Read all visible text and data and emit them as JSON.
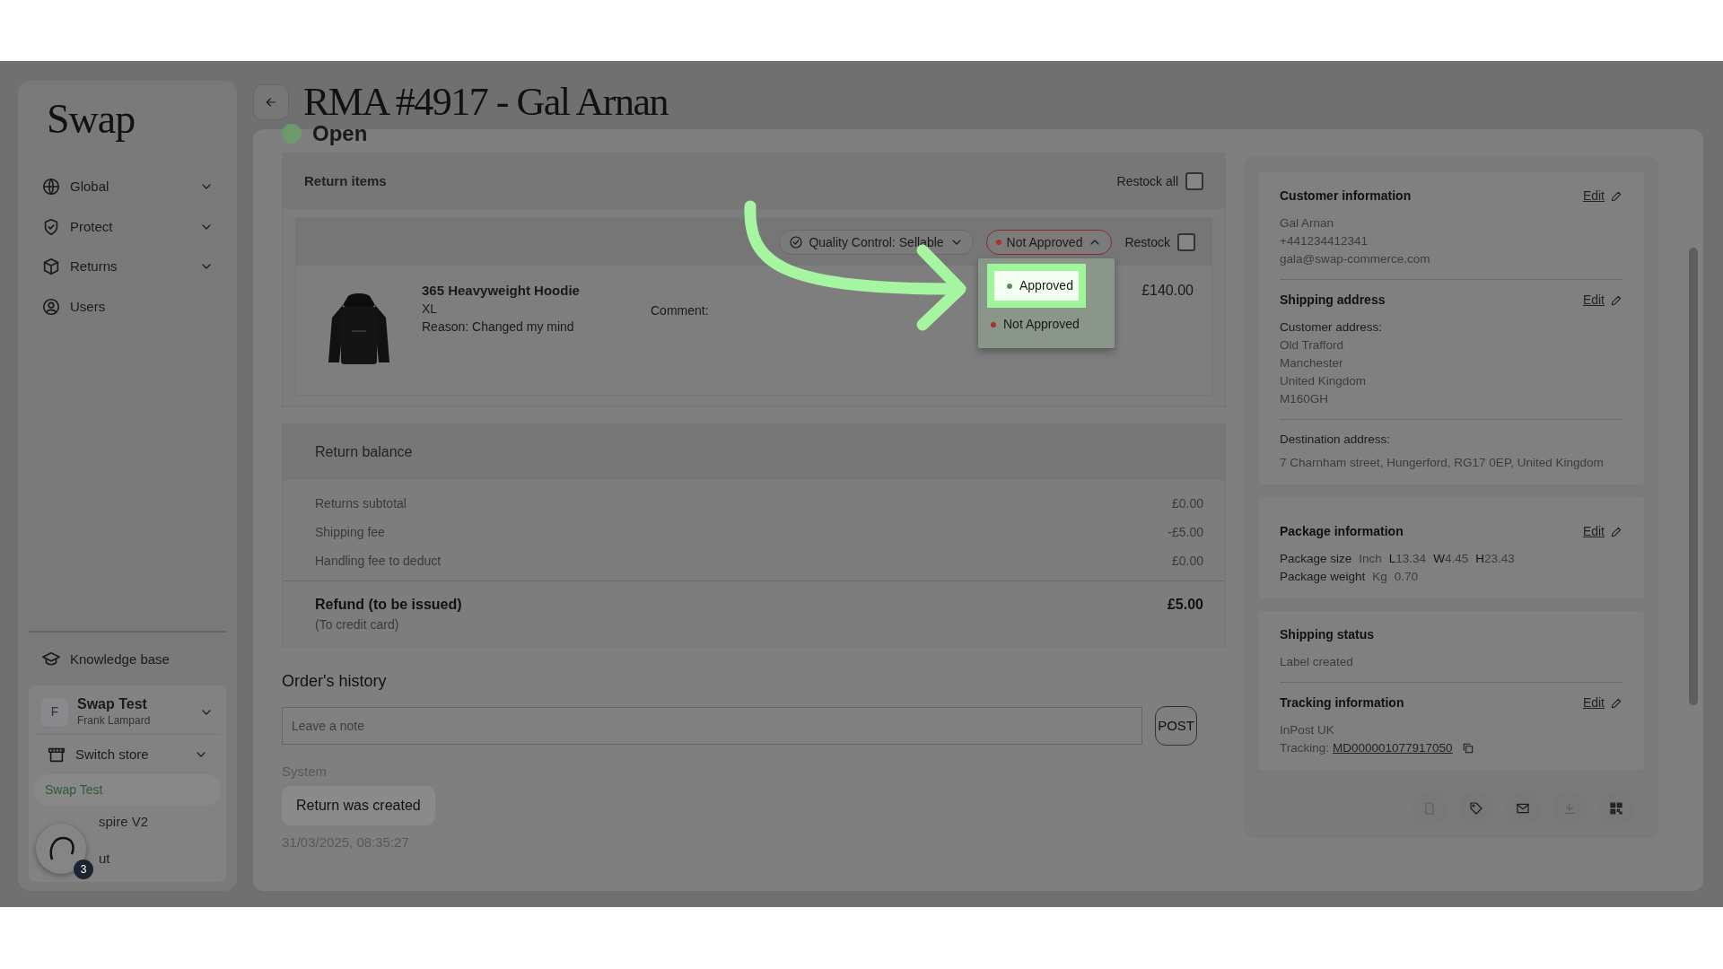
{
  "sidebar": {
    "logo": "Swap",
    "nav": [
      {
        "label": "Global",
        "expandable": true
      },
      {
        "label": "Protect",
        "expandable": true
      },
      {
        "label": "Returns",
        "expandable": true
      },
      {
        "label": "Users",
        "expandable": false
      }
    ],
    "knowledge_base": "Knowledge base",
    "account": {
      "initial": "F",
      "name": "Swap Test",
      "user": "Frank Lampard"
    },
    "switch_store": "Switch store",
    "stores": [
      {
        "label": "Swap Test",
        "selected": true
      },
      {
        "label": "spire V2",
        "selected": false
      }
    ],
    "logout": "ut",
    "chat": {
      "badge": "3"
    }
  },
  "header": {
    "title": "RMA #4917 - Gal Arnan",
    "status": "Open"
  },
  "return_items": {
    "title": "Return items",
    "restock_all": {
      "label": "Restock all",
      "checked": false
    },
    "items": [
      {
        "qc": "Quality Control: Sellable",
        "approval": "Not Approved",
        "restock": {
          "label": "Restock",
          "checked": false
        },
        "name": "365 Heavyweight Hoodie",
        "size": "XL",
        "reason": "Reason: Changed my mind",
        "comment": "Comment:",
        "price": "£140.00",
        "menu_open": true
      }
    ]
  },
  "approval_menu": [
    {
      "label": "Approved",
      "color": "#5c8f5c",
      "highlighted": true
    },
    {
      "label": "Not Approved",
      "color": "#a83232",
      "highlighted": false
    }
  ],
  "return_balance": {
    "title": "Return balance",
    "rows": [
      {
        "label": "Returns subtotal",
        "value": "£0.00"
      },
      {
        "label": "Shipping fee",
        "value": "-£5.00"
      },
      {
        "label": "Handling fee to deduct",
        "value": "£0.00"
      }
    ],
    "total": {
      "label": "Refund (to be issued)",
      "note": "(To credit card)",
      "value": "£5.00"
    }
  },
  "history": {
    "title": "Order's history",
    "placeholder": "Leave a note",
    "post": "POST",
    "entries": [
      {
        "author": "System",
        "message": "Return was created",
        "time": "31/03/2025, 08:35:27"
      }
    ]
  },
  "customer": {
    "title": "Customer information",
    "edit": "Edit",
    "lines": [
      "Gal Arnan",
      "+441234412341",
      "gala@swap-commerce.com"
    ]
  },
  "shipping_address": {
    "title": "Shipping address",
    "edit": "Edit",
    "customer_label": "Customer address:",
    "lines": [
      "Old Trafford",
      "Manchester",
      "United Kingdom",
      "M160GH"
    ],
    "destination_label": "Destination address:",
    "destination": "7 Charnham street, Hungerford, RG17 0EP, United Kingdom"
  },
  "package": {
    "title": "Package information",
    "edit": "Edit",
    "size_label": "Package size",
    "size_unit": "Inch",
    "dims": [
      {
        "key": "L",
        "value": "13.34"
      },
      {
        "key": "W",
        "value": "4.45"
      },
      {
        "key": "H",
        "value": "23.43"
      }
    ],
    "weight_label": "Package weight",
    "weight_unit": "Kg",
    "weight": "0.70"
  },
  "shipping_status": {
    "title": "Shipping status",
    "value": "Label created"
  },
  "tracking": {
    "title": "Tracking information",
    "edit": "Edit",
    "carrier": "InPost UK",
    "label": "Tracking:",
    "number": "MD000001077917050"
  },
  "actions": [
    {
      "disabled": true
    },
    {
      "disabled": false
    },
    {
      "disabled": false
    },
    {
      "disabled": true
    },
    {
      "disabled": false
    }
  ]
}
